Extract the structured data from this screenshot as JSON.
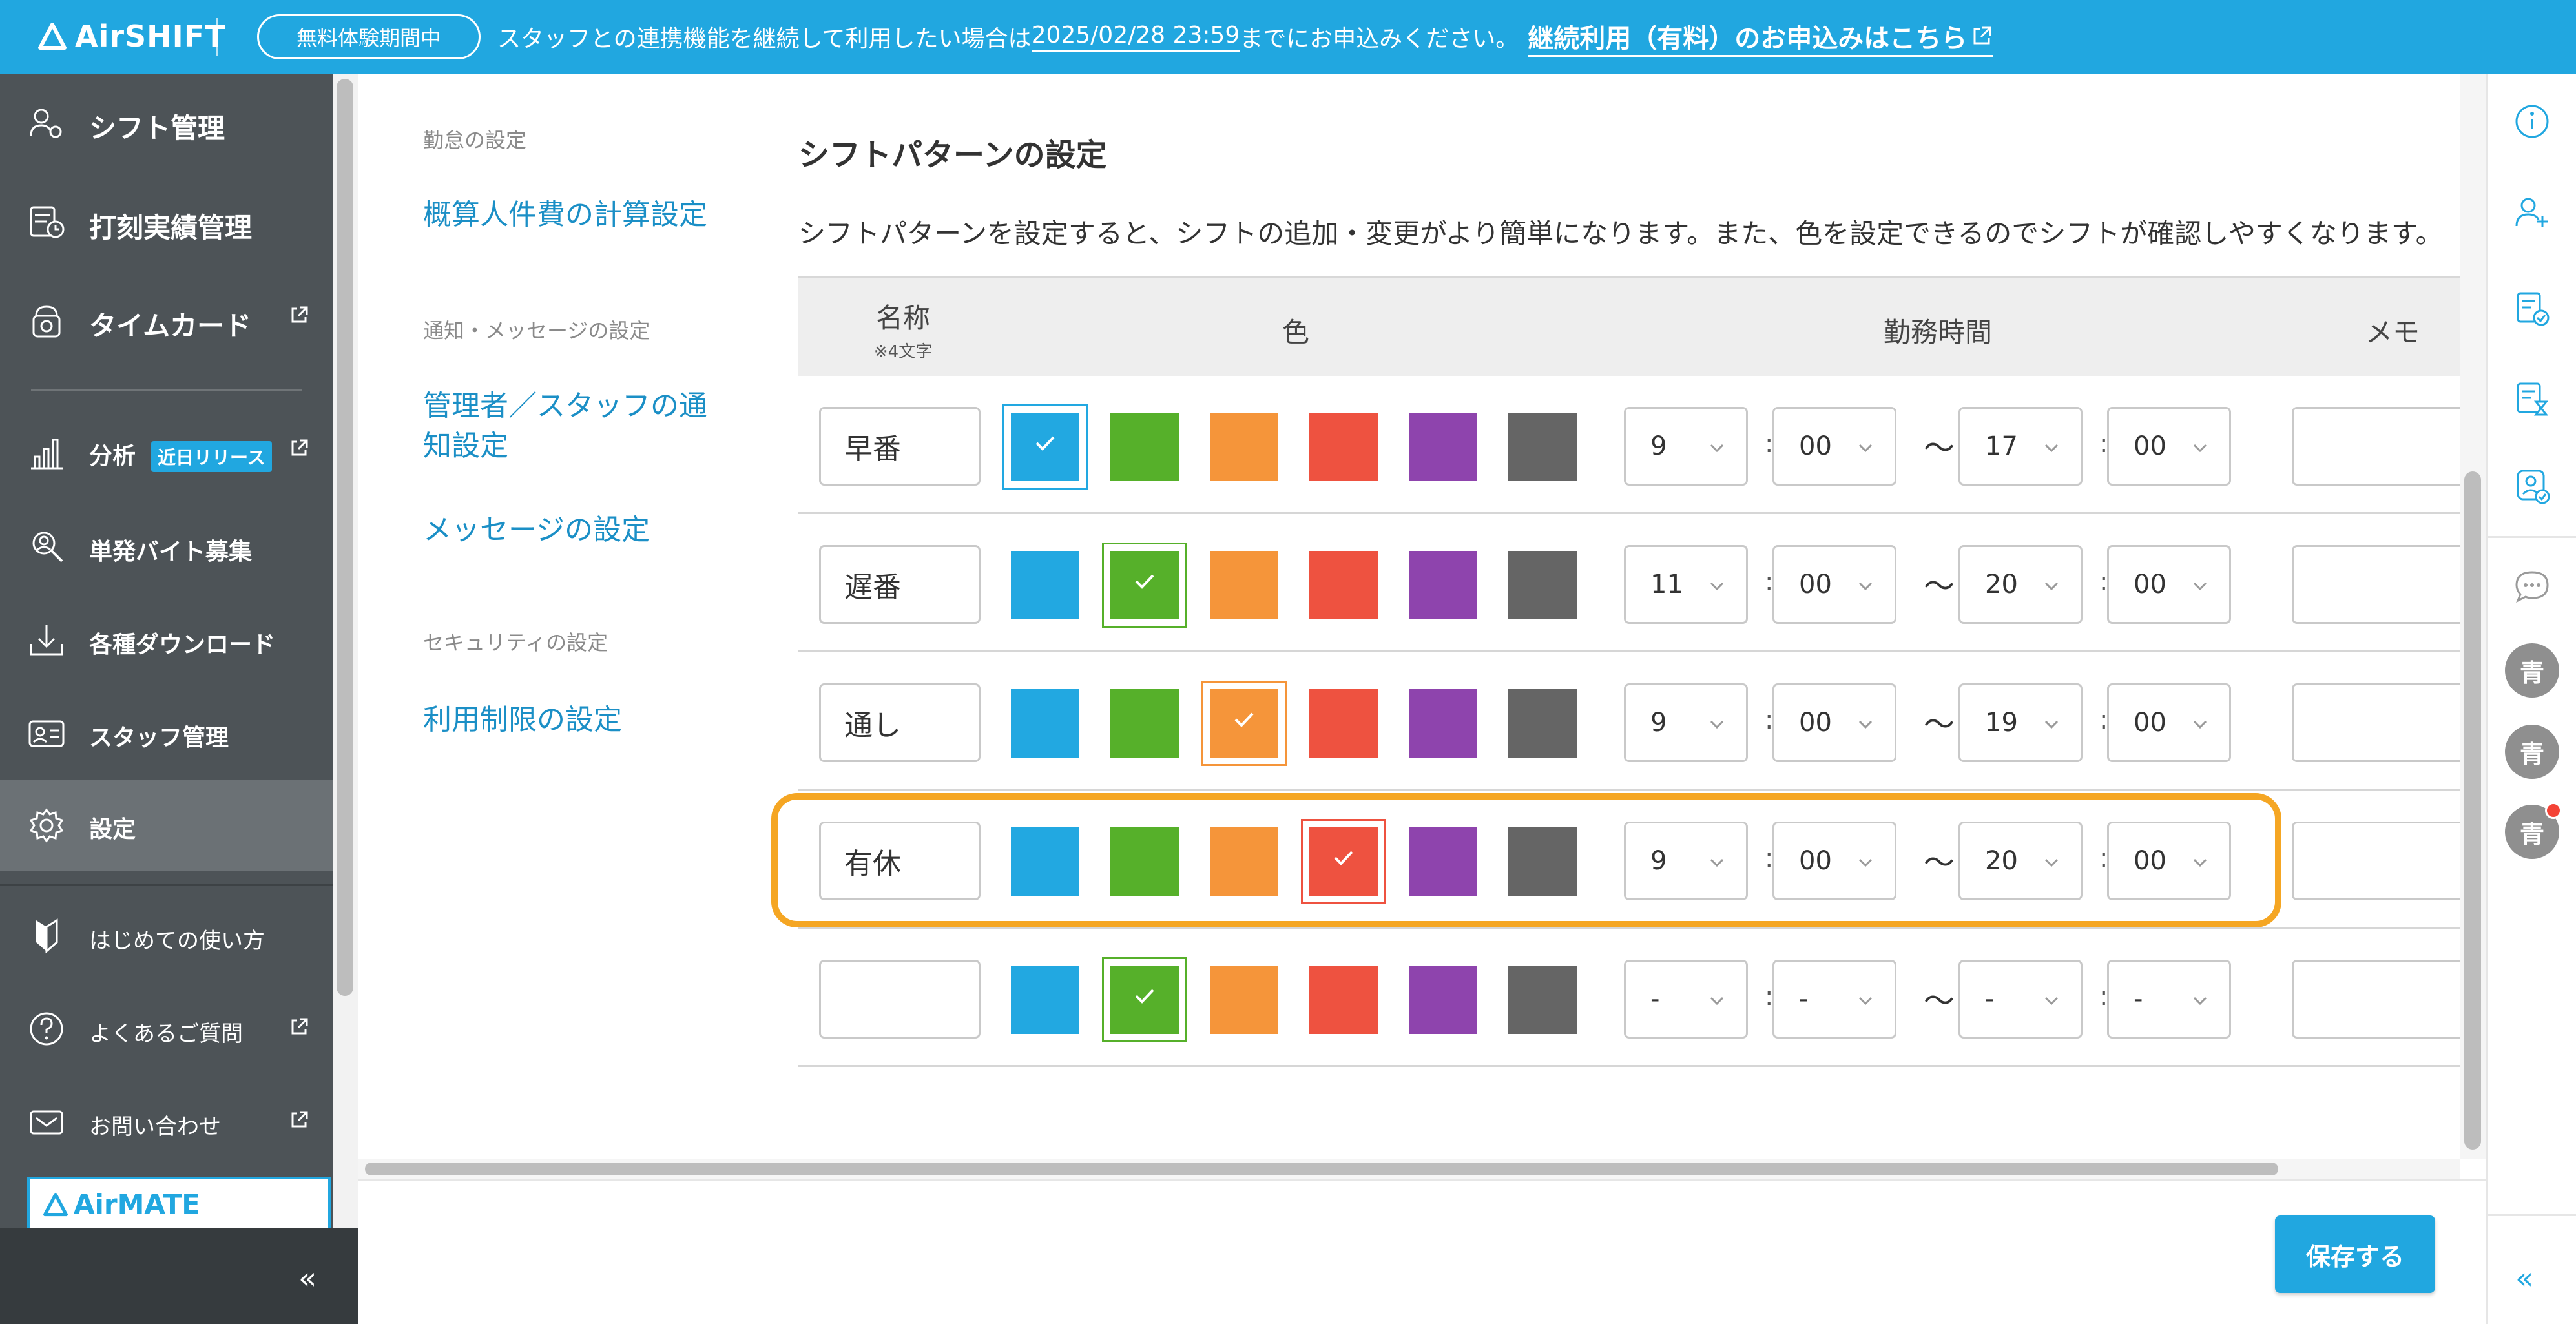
{
  "header": {
    "logo": "AirSHIFT",
    "trial_badge": "無料体験期間中",
    "notice_prefix": "スタッフとの連携機能を継続して利用したい場合は",
    "notice_deadline": "2025/02/28 23:59",
    "notice_suffix": "までにお申込みください。",
    "cta_label": "継続利用（有料）のお申込みはこちら"
  },
  "sidebar": {
    "items": [
      {
        "label": "シフト管理",
        "icon": "people-gear-icon"
      },
      {
        "label": "打刻実績管理",
        "icon": "stamp-record-icon"
      },
      {
        "label": "タイムカード",
        "icon": "time-card-icon"
      },
      {
        "label": "分析",
        "icon": "chart-bar-icon",
        "badge": "近日リリース"
      },
      {
        "label": "単発バイト募集",
        "icon": "person-search-icon"
      },
      {
        "label": "各種ダウンロード",
        "icon": "download-icon"
      },
      {
        "label": "スタッフ管理",
        "icon": "id-card-icon"
      },
      {
        "label": "設定",
        "icon": "gear-icon"
      },
      {
        "label": "はじめての使い方",
        "icon": "beginner-mark-icon"
      },
      {
        "label": "よくあるご質問",
        "icon": "question-circle-icon"
      },
      {
        "label": "お問い合わせ",
        "icon": "mail-icon"
      }
    ],
    "promo": "AirMATE"
  },
  "subnav": {
    "groups": [
      {
        "heading": "勤怠の設定",
        "links": [
          "概算人件費の計算設定"
        ]
      },
      {
        "heading": "通知・メッセージの設定",
        "links": [
          "管理者／スタッフの通知設定",
          "メッセージの設定"
        ]
      },
      {
        "heading": "セキュリティの設定",
        "links": [
          "利用制限の設定"
        ]
      }
    ]
  },
  "main": {
    "title": "シフトパターンの設定",
    "description": "シフトパターンを設定すると、シフトの追加・変更がより簡単になります。また、色を設定できるのでシフトが確認しやすくなります。",
    "columns": {
      "name": "名称",
      "name_note": "※4文字",
      "color": "色",
      "hours": "勤務時間",
      "memo": "メモ"
    },
    "tilde": "〜",
    "colon": ":",
    "colors": [
      "#22a8e1",
      "#56b02a",
      "#f5953a",
      "#ee5240",
      "#8e44ad",
      "#656565"
    ],
    "patterns": [
      {
        "name": "早番",
        "color_index": 0,
        "start_h": "9",
        "start_m": "00",
        "end_h": "17",
        "end_m": "00"
      },
      {
        "name": "遅番",
        "color_index": 1,
        "start_h": "11",
        "start_m": "00",
        "end_h": "20",
        "end_m": "00"
      },
      {
        "name": "通し",
        "color_index": 2,
        "start_h": "9",
        "start_m": "00",
        "end_h": "19",
        "end_m": "00"
      },
      {
        "name": "有休",
        "color_index": 3,
        "start_h": "9",
        "start_m": "00",
        "end_h": "20",
        "end_m": "00"
      },
      {
        "name": "",
        "color_index": 1,
        "start_h": "-",
        "start_m": "-",
        "end_h": "-",
        "end_m": "-"
      }
    ],
    "save_label": "保存する"
  },
  "right_rail": {
    "icons": [
      "info-icon",
      "add-person-icon",
      "shift-check-icon",
      "hourglass-doc-icon",
      "person-check-icon",
      "chat-bubble-icon"
    ],
    "avatars": [
      "青",
      "青",
      "青"
    ],
    "collapse": "«"
  },
  "left_collapse": "«"
}
